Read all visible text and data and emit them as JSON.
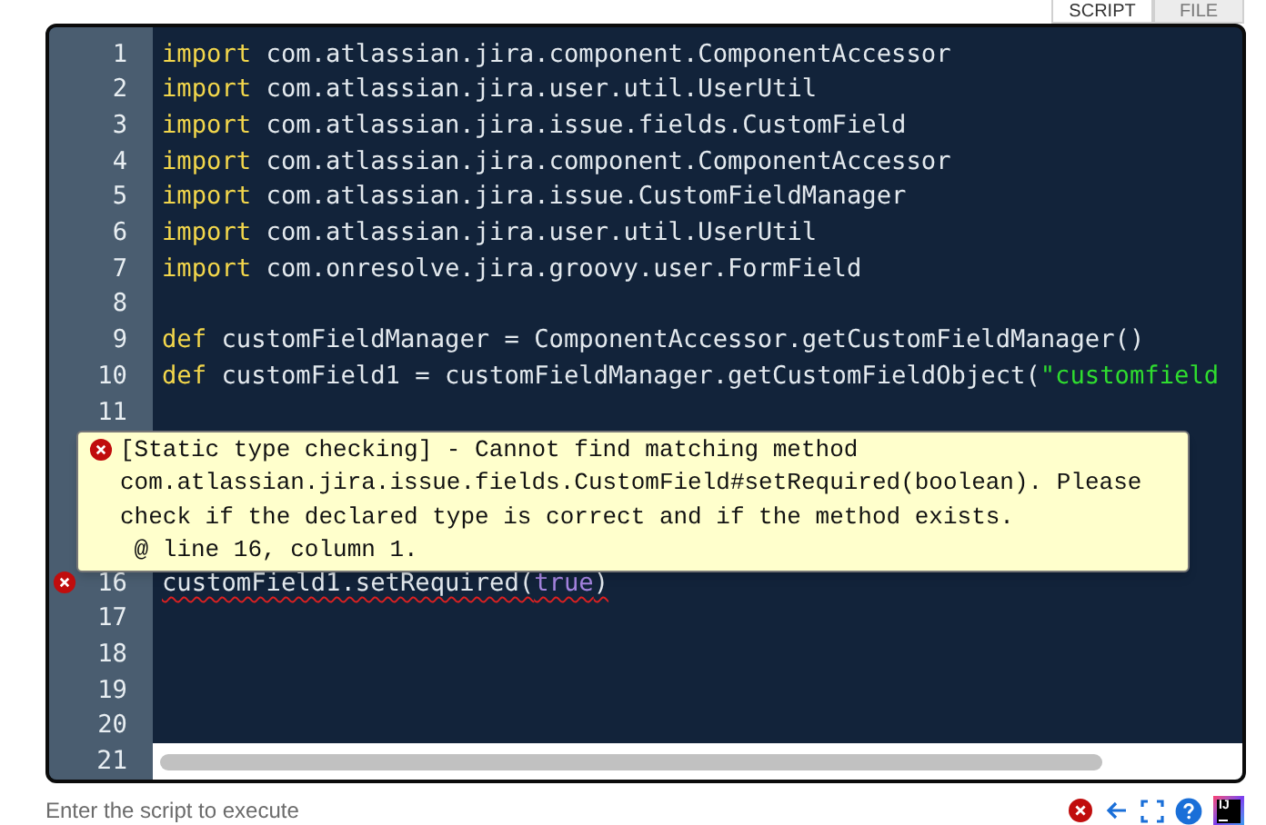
{
  "tabs": [
    {
      "label": "SCRIPT",
      "selected": true
    },
    {
      "label": "FILE",
      "selected": false
    }
  ],
  "editor": {
    "lines": [
      {
        "kind": "code",
        "number": "1",
        "error": false,
        "tokens": [
          {
            "kind": "keyword",
            "text": "import"
          },
          {
            "kind": "plain",
            "text": " com.atlassian.jira.component.ComponentAccessor"
          }
        ]
      },
      {
        "kind": "code",
        "number": "2",
        "error": false,
        "tokens": [
          {
            "kind": "keyword",
            "text": "import"
          },
          {
            "kind": "plain",
            "text": " com.atlassian.jira.user.util.UserUtil"
          }
        ]
      },
      {
        "kind": "code",
        "number": "3",
        "error": false,
        "tokens": [
          {
            "kind": "keyword",
            "text": "import"
          },
          {
            "kind": "plain",
            "text": " com.atlassian.jira.issue.fields.CustomField"
          }
        ]
      },
      {
        "kind": "code",
        "number": "4",
        "error": false,
        "tokens": [
          {
            "kind": "keyword",
            "text": "import"
          },
          {
            "kind": "plain",
            "text": " com.atlassian.jira.component.ComponentAccessor"
          }
        ]
      },
      {
        "kind": "code",
        "number": "5",
        "error": false,
        "tokens": [
          {
            "kind": "keyword",
            "text": "import"
          },
          {
            "kind": "plain",
            "text": " com.atlassian.jira.issue.CustomFieldManager"
          }
        ]
      },
      {
        "kind": "code",
        "number": "6",
        "error": false,
        "tokens": [
          {
            "kind": "keyword",
            "text": "import"
          },
          {
            "kind": "plain",
            "text": " com.atlassian.jira.user.util.UserUtil"
          }
        ]
      },
      {
        "kind": "code",
        "number": "7",
        "error": false,
        "tokens": [
          {
            "kind": "keyword",
            "text": "import"
          },
          {
            "kind": "plain",
            "text": " com.onresolve.jira.groovy.user.FormField"
          }
        ]
      },
      {
        "kind": "code",
        "number": "8",
        "error": false
      },
      {
        "kind": "code",
        "number": "9",
        "error": false,
        "tokens": [
          {
            "kind": "keyword",
            "text": "def"
          },
          {
            "kind": "plain",
            "text": " customFieldManager = ComponentAccessor.getCustomFieldManager()"
          }
        ]
      },
      {
        "kind": "code",
        "number": "10",
        "error": false,
        "tokens": [
          {
            "kind": "keyword",
            "text": "def"
          },
          {
            "kind": "plain",
            "text": " customField1 = customFieldManager.getCustomFieldObject("
          },
          {
            "kind": "string",
            "text": "\"customfield"
          }
        ]
      },
      {
        "kind": "code",
        "number": "11",
        "error": false
      },
      {
        "kind": "tooltip",
        "lines": [
          "[Static type checking] - Cannot find matching method",
          "com.atlassian.jira.issue.fields.CustomField#setRequired(boolean). Please",
          "check if the declared type is correct and if the method exists.",
          " @ line 16, column 1."
        ]
      },
      {
        "kind": "code",
        "number": "16",
        "error": true,
        "tokens": [
          {
            "kind": "plain",
            "text": "customField1.setRequired("
          },
          {
            "kind": "boolean",
            "text": "true"
          },
          {
            "kind": "plain",
            "text": ")"
          }
        ]
      },
      {
        "kind": "code",
        "number": "17",
        "error": false
      },
      {
        "kind": "code",
        "number": "18",
        "error": false
      },
      {
        "kind": "code",
        "number": "19",
        "error": false
      },
      {
        "kind": "code",
        "number": "20",
        "error": false
      },
      {
        "kind": "scroll",
        "number": "21"
      }
    ]
  },
  "footer": {
    "hint": "Enter the script to execute",
    "logo_text": "IJ"
  }
}
